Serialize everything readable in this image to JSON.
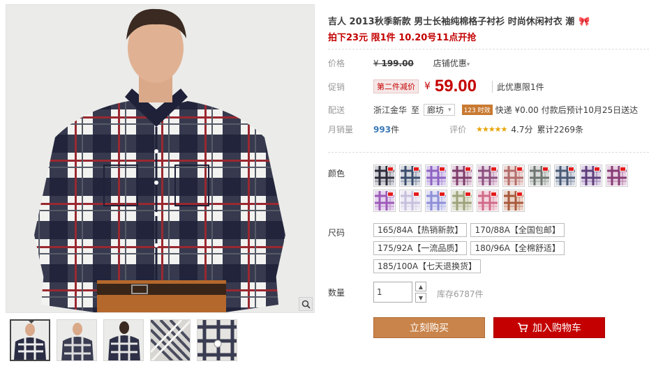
{
  "product": {
    "title": "吉人 2013秋季新款 男士长袖纯棉格子衬衫 时尚休闲衬衣 潮",
    "promo_line": "拍下23元 限1件 10.20号11点开抢"
  },
  "price": {
    "label": "价格",
    "currency": "¥",
    "original": "199.00",
    "shop_discount": "店铺优惠"
  },
  "promotion": {
    "label": "促销",
    "tag": "第二件减价",
    "currency": "¥",
    "price": "59.00",
    "limit": "此优惠限1件"
  },
  "shipping": {
    "label": "配送",
    "from": "浙江金华",
    "to_word": "至",
    "destination": "廊坊",
    "badge": "123 时效",
    "info": "快递 ¥0.00 付款后预计10月25日送达"
  },
  "sales": {
    "label": "月销量",
    "count": "993",
    "unit": "件",
    "rating_label": "评价",
    "stars": "★★★★★",
    "score": "4.7分",
    "reviews": "累计2269条"
  },
  "colors": {
    "label": "颜色",
    "swatches": [
      {
        "c1": "#2c2c3a",
        "c2": "#cfd0d6"
      },
      {
        "c1": "#3b4e6d",
        "c2": "#d5d9e0"
      },
      {
        "c1": "#8e63c2",
        "c2": "#dcd0f0"
      },
      {
        "c1": "#7e3c6a",
        "c2": "#e5cfe0"
      },
      {
        "c1": "#8b4f7e",
        "c2": "#e8d3e3"
      },
      {
        "c1": "#b26d6a",
        "c2": "#ecd6d4"
      },
      {
        "c1": "#6f7672",
        "c2": "#d9dcda"
      },
      {
        "c1": "#4a5a76",
        "c2": "#d3d8e2"
      },
      {
        "c1": "#5f3e7a",
        "c2": "#ddd1e8"
      },
      {
        "c1": "#863c74",
        "c2": "#e9d1e4"
      },
      {
        "c1": "#9c5bb8",
        "c2": "#e6d4ee"
      },
      {
        "c1": "#c7c0dc",
        "c2": "#f0edf6"
      },
      {
        "c1": "#8e8fd6",
        "c2": "#dfe0f6"
      },
      {
        "c1": "#9ea37c",
        "c2": "#e2e4d4"
      },
      {
        "c1": "#d06a87",
        "c2": "#f3d5df"
      },
      {
        "c1": "#a85a3c",
        "c2": "#ecd4c8"
      }
    ]
  },
  "sizes": {
    "label": "尺码",
    "options": [
      "165/84A【热销新款】",
      "170/88A【全国包邮】",
      "175/92A【一流品质】",
      "180/96A【全棉舒适】",
      "185/100A【七天退换货】"
    ]
  },
  "quantity": {
    "label": "数量",
    "value": "1",
    "stock": "库存6787件"
  },
  "actions": {
    "buy_now": "立刻购买",
    "add_to_cart": "加入购物车"
  },
  "icons": {
    "zoom": "magnifier-icon",
    "cart": "cart-icon",
    "title_badge": "ribbon-icon"
  }
}
